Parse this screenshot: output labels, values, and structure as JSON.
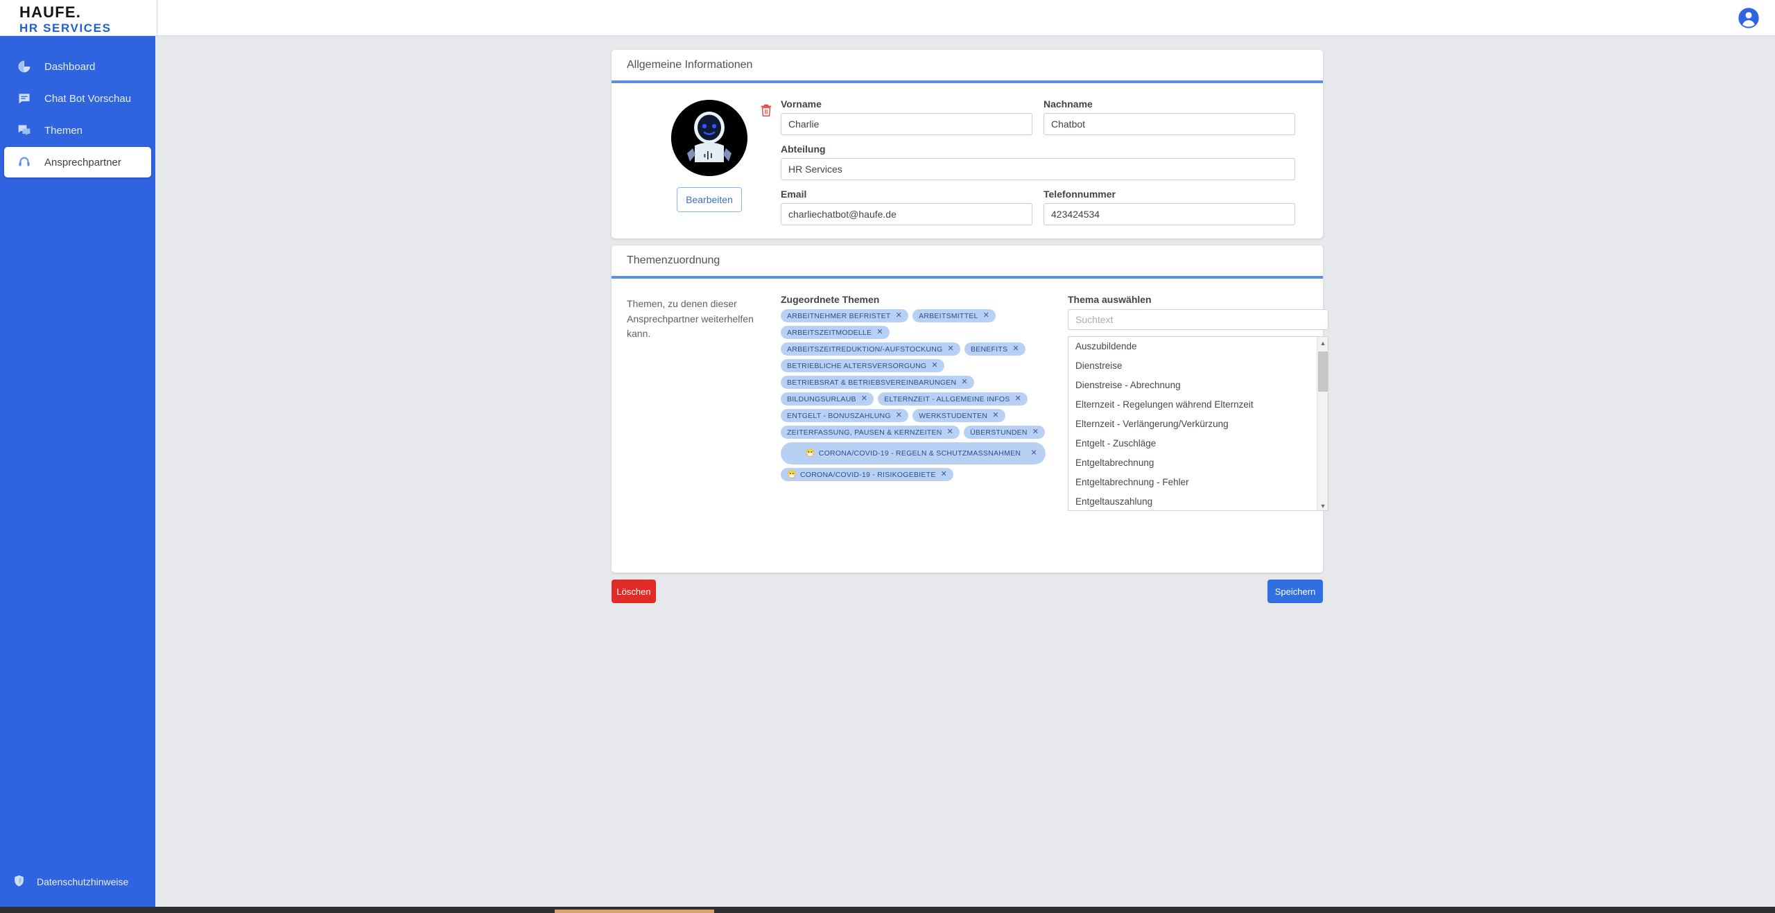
{
  "app": {
    "logo_main": "HAUFE.",
    "logo_sub": "HR SERVICES",
    "account_icon": "account-circle-icon"
  },
  "sidebar": {
    "items": [
      {
        "label": "Dashboard",
        "icon": "pie-chart-icon",
        "active": false
      },
      {
        "label": "Chat Bot Vorschau",
        "icon": "chat-bubble-icon",
        "active": false
      },
      {
        "label": "Themen",
        "icon": "chat-bubbles-icon",
        "active": false
      },
      {
        "label": "Ansprechpartner",
        "icon": "headset-icon",
        "active": true
      }
    ],
    "footer": {
      "label": "Datenschutzhinweise",
      "icon": "shield-icon"
    }
  },
  "general_card": {
    "title": "Allgemeine Informationen",
    "avatar": {
      "alt": "robot-avatar",
      "edit_label": "Bearbeiten",
      "delete_icon": "trash-icon"
    },
    "fields": [
      {
        "label": "Vorname",
        "value": "Charlie",
        "placeholder": ""
      },
      {
        "label": "Nachname",
        "value": "Chatbot",
        "placeholder": ""
      },
      {
        "label": "Abteilung",
        "value": "HR Services",
        "placeholder": ""
      },
      {
        "label": "Email",
        "value": "charliechatbot@haufe.de",
        "placeholder": ""
      },
      {
        "label": "Telefonnummer",
        "value": "423424534",
        "placeholder": ""
      }
    ]
  },
  "topics_card": {
    "title": "Themenzuordnung",
    "hint": "Themen, zu denen dieser Ansprechpartner weiterhelfen kann.",
    "assigned_label": "Zugeordnete Themen",
    "assigned_tags": [
      {
        "text": "ARBEITNEHMER BEFRISTET",
        "emoji": "",
        "wide": false
      },
      {
        "text": "ARBEITSMITTEL",
        "emoji": "",
        "wide": false
      },
      {
        "text": "ARBEITSZEITMODELLE",
        "emoji": "",
        "wide": false
      },
      {
        "text": "ARBEITSZEITREDUKTION/-AUFSTOCKUNG",
        "emoji": "",
        "wide": false
      },
      {
        "text": "BENEFITS",
        "emoji": "",
        "wide": false
      },
      {
        "text": "BETRIEBLICHE ALTERSVERSORGUNG",
        "emoji": "",
        "wide": false
      },
      {
        "text": "BETRIEBSRAT & BETRIEBSVEREINBARUNGEN",
        "emoji": "",
        "wide": false
      },
      {
        "text": "BILDUNGSURLAUB",
        "emoji": "",
        "wide": false
      },
      {
        "text": "ELTERNZEIT - ALLGEMEINE INFOS",
        "emoji": "",
        "wide": false
      },
      {
        "text": "ENTGELT - BONUSZAHLUNG",
        "emoji": "",
        "wide": false
      },
      {
        "text": "WERKSTUDENTEN",
        "emoji": "",
        "wide": false
      },
      {
        "text": "ZEITERFASSUNG, PAUSEN & KERNZEITEN",
        "emoji": "",
        "wide": false
      },
      {
        "text": "ÜBERSTUNDEN",
        "emoji": "",
        "wide": false
      },
      {
        "text": "CORONA/COVID-19 - REGELN & SCHUTZMASSNAHMEN",
        "emoji": "😷",
        "wide": true
      },
      {
        "text": "CORONA/COVID-19 - RISIKOGEBIETE",
        "emoji": "😷",
        "wide": false
      }
    ],
    "select_label": "Thema auswählen",
    "search_placeholder": "Suchtext",
    "search_value": "",
    "options": [
      "Auszubildende",
      "Dienstreise",
      "Dienstreise - Abrechnung",
      "Elternzeit - Regelungen während Elternzeit",
      "Elternzeit - Verlängerung/Verkürzung",
      "Entgelt - Zuschläge",
      "Entgeltabrechnung",
      "Entgeltabrechnung - Fehler",
      "Entgeltauszahlung"
    ],
    "scrollbar": {
      "up_icon": "chevron-up-icon",
      "down_icon": "chevron-down-icon"
    }
  },
  "actions": {
    "delete_label": "Löschen",
    "save_label": "Speichern"
  },
  "colors": {
    "brand_blue": "#2f63e0",
    "rule_blue": "#5b91e0",
    "chip_bg": "#b9d0f5",
    "chip_fg": "#2b4f86",
    "danger": "#e02b27",
    "canvas": "#e6e8eb"
  }
}
